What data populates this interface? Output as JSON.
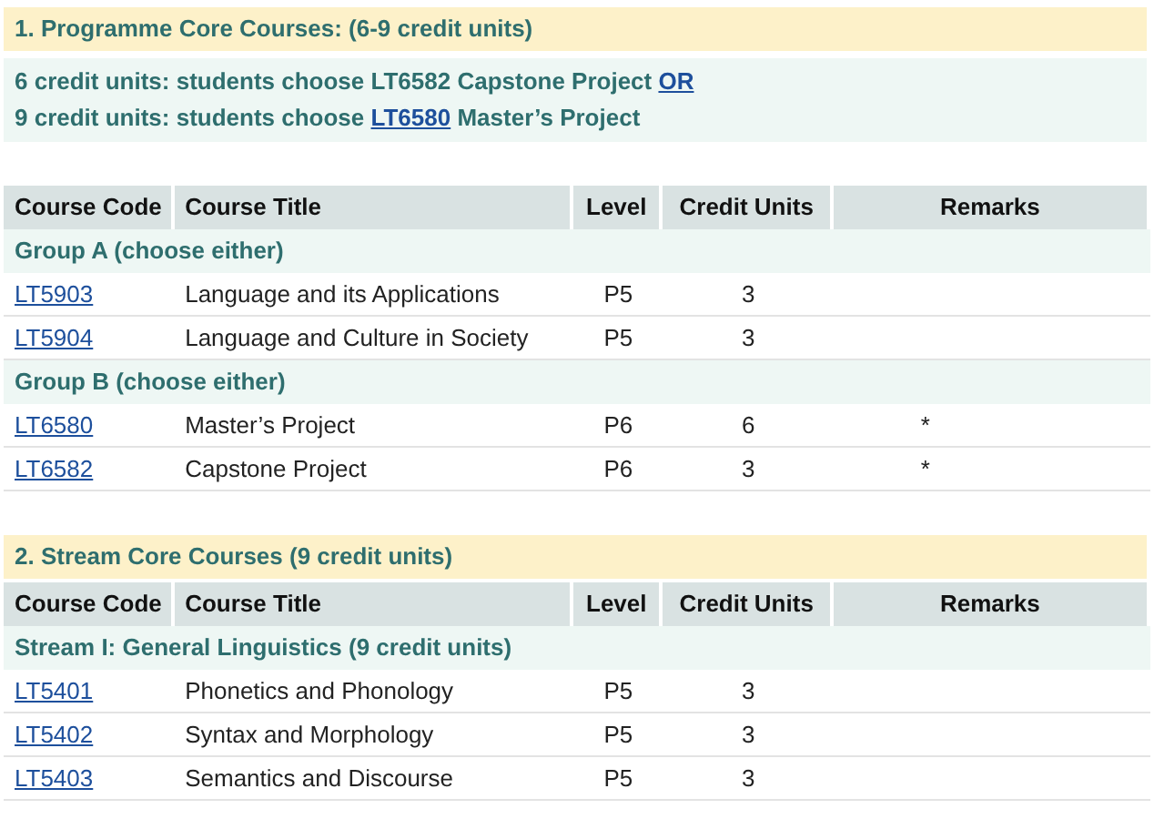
{
  "sections": [
    {
      "title": "1. Programme Core Courses: (6-9 credit units)",
      "notes": [
        {
          "parts": [
            {
              "kind": "text",
              "text": "6 credit units: students choose LT6582 Capstone Project "
            },
            {
              "kind": "link",
              "text": "OR"
            }
          ]
        },
        {
          "parts": [
            {
              "kind": "text",
              "text": "9 credit units: students choose "
            },
            {
              "kind": "link",
              "text": "LT6580"
            },
            {
              "kind": "text",
              "text": " Master’s Project"
            }
          ]
        }
      ],
      "table": {
        "columns": [
          "Course Code",
          "Course Title",
          "Level",
          "Credit Units",
          "Remarks"
        ],
        "groups": [
          {
            "title": "Group A (choose either)",
            "rows": [
              {
                "code": "LT5903",
                "title": "Language and its Applications",
                "level": "P5",
                "credits": "3"
              },
              {
                "code": "LT5904",
                "title": "Language and Culture in Society",
                "level": "P5",
                "credits": "3"
              }
            ]
          },
          {
            "title": "Group B (choose either)",
            "rows": [
              {
                "code": "LT6580",
                "title": "Master’s Project",
                "level": "P6",
                "credits": "6",
                "remarks": "*"
              },
              {
                "code": "LT6582",
                "title": "Capstone Project",
                "level": "P6",
                "credits": "3",
                "remarks": "*"
              }
            ]
          }
        ]
      }
    },
    {
      "title": "2. Stream Core Courses (9 credit units)",
      "table": {
        "columns": [
          "Course Code",
          "Course Title",
          "Level",
          "Credit Units",
          "Remarks"
        ],
        "groups": [
          {
            "title": "Stream I: General Linguistics (9 credit units)",
            "rows": [
              {
                "code": "LT5401",
                "title": "Phonetics and Phonology",
                "level": "P5",
                "credits": "3"
              },
              {
                "code": "LT5402",
                "title": "Syntax and Morphology",
                "level": "P5",
                "credits": "3"
              },
              {
                "code": "LT5403",
                "title": "Semantics and Discourse",
                "level": "P5",
                "credits": "3"
              }
            ]
          }
        ]
      }
    }
  ]
}
